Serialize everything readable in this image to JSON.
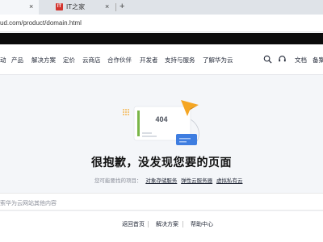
{
  "browser": {
    "tab_active_close": "×",
    "tab2": {
      "favicon_text": "IT",
      "title": "IT之家",
      "close": "×"
    },
    "new_tab": "+",
    "url": "ud.com/product/domain.html"
  },
  "nav": {
    "items": [
      "动",
      "产品",
      "解决方案",
      "定价",
      "云商店",
      "合作伙伴",
      "开发者",
      "支持与服务",
      "了解华为云"
    ],
    "right": [
      "文档",
      "备案"
    ]
  },
  "error": {
    "code": "404",
    "title": "很抱歉，没发现您要的页面",
    "hint_label": "您可能要找的项目：",
    "links": [
      "对象存储服务",
      "弹性云服务器",
      "虚拟私有云"
    ]
  },
  "search": {
    "placeholder": "索华为云网站其他内容"
  },
  "footer": {
    "links": [
      "返回首页",
      "解决方案",
      "帮助中心"
    ]
  },
  "colors": {
    "accent_orange": "#f5a623",
    "error_green": "#7ab648",
    "brand_blue": "#3e7de0"
  }
}
